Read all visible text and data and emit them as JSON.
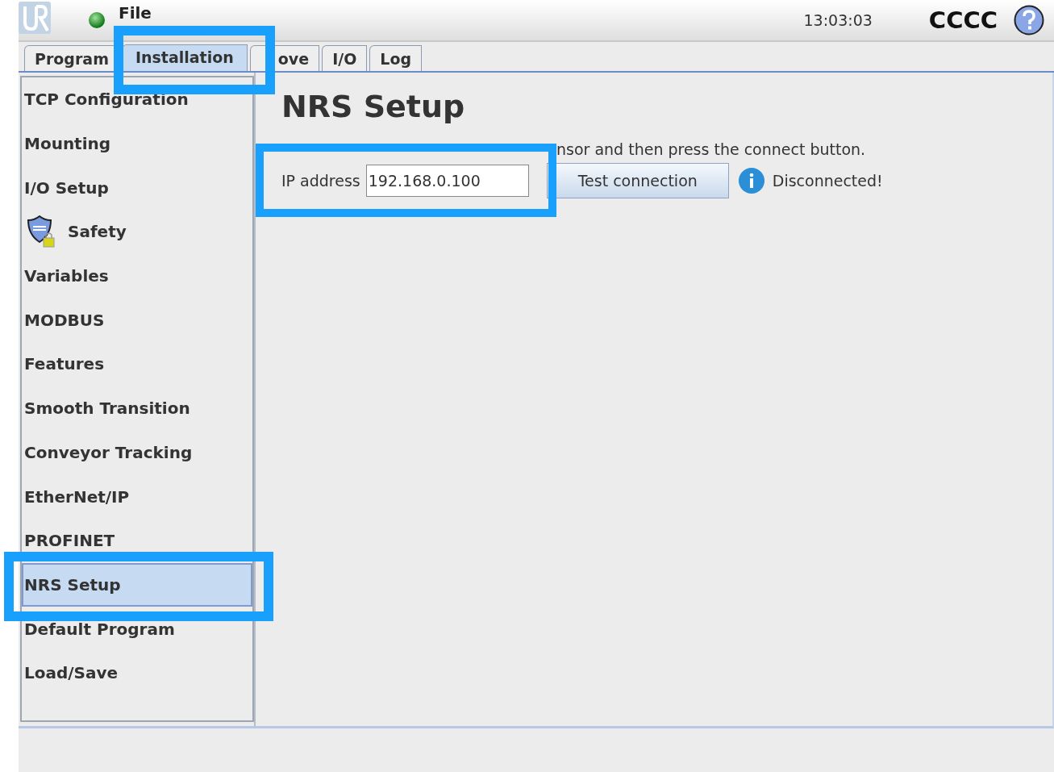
{
  "header": {
    "menu": "File",
    "clock": "13:03:03",
    "robot_name": "CCCC"
  },
  "tabs": [
    {
      "label": "Program",
      "selected": false
    },
    {
      "label": "Installation",
      "selected": true
    },
    {
      "label": "ove",
      "selected": false
    },
    {
      "label": "I/O",
      "selected": false
    },
    {
      "label": "Log",
      "selected": false
    }
  ],
  "sidebar": {
    "items": [
      {
        "label": "TCP Configuration",
        "selected": false,
        "kind": "text"
      },
      {
        "label": "Mounting",
        "selected": false,
        "kind": "text"
      },
      {
        "label": "I/O Setup",
        "selected": false,
        "kind": "text"
      },
      {
        "label": "Safety",
        "selected": false,
        "kind": "locked"
      },
      {
        "label": "Variables",
        "selected": false,
        "kind": "text"
      },
      {
        "label": "MODBUS",
        "selected": false,
        "kind": "text"
      },
      {
        "label": "Features",
        "selected": false,
        "kind": "text"
      },
      {
        "label": "Smooth Transition",
        "selected": false,
        "kind": "text"
      },
      {
        "label": "Conveyor Tracking",
        "selected": false,
        "kind": "text"
      },
      {
        "label": "EtherNet/IP",
        "selected": false,
        "kind": "text"
      },
      {
        "label": "PROFINET",
        "selected": false,
        "kind": "text"
      },
      {
        "label": "NRS Setup",
        "selected": true,
        "kind": "text"
      },
      {
        "label": "Default Program",
        "selected": false,
        "kind": "text"
      },
      {
        "label": "Load/Save",
        "selected": false,
        "kind": "text"
      }
    ]
  },
  "content": {
    "title": "NRS Setup",
    "instruction": "nsor and then press the connect button.",
    "ip_label": "IP address",
    "ip_value": "192.168.0.100",
    "test_button": "Test connection",
    "status": "Disconnected!"
  }
}
